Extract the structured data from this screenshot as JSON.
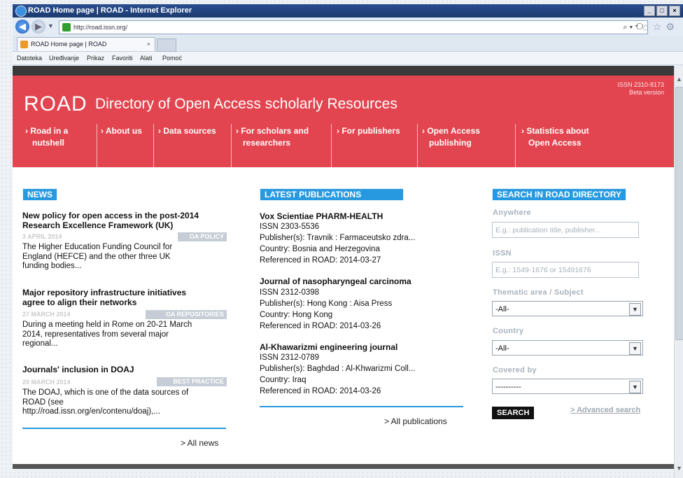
{
  "browser": {
    "title": "ROAD Home page | ROAD - Internet Explorer",
    "url": "http://road.issn.org/",
    "tab_label": "ROAD Home page | ROAD",
    "menu": [
      "Datoteka",
      "Uređivanje",
      "Prikaz",
      "Favoriti",
      "Alati",
      "Pomoć"
    ]
  },
  "header": {
    "issn": "ISSN 2310-8173",
    "beta": "Beta version",
    "logo": "ROAD",
    "subtitle": "Directory of Open Access scholarly Resources",
    "nav": [
      {
        "l1": "› Road in a",
        "l2": "nutshell"
      },
      {
        "l1": "› About us",
        "l2": ""
      },
      {
        "l1": "› Data sources",
        "l2": ""
      },
      {
        "l1": "› For scholars and",
        "l2": "researchers"
      },
      {
        "l1": "› For publishers",
        "l2": ""
      },
      {
        "l1": "› Open Access",
        "l2": "publishing"
      },
      {
        "l1": "› Statistics about",
        "l2": "Open Access"
      }
    ]
  },
  "news": {
    "heading": "NEWS",
    "items": [
      {
        "title1": "New policy for open access in the post-2014",
        "title2": "Research Excellence Framework (UK)",
        "date": "3 APRIL 2014",
        "badge": "OA POLICY",
        "t1": "The Higher Education Funding Council for",
        "t2": "England (HEFCE) and the other three UK",
        "t3": "funding bodies..."
      },
      {
        "title1": "Major repository infrastructure initiatives",
        "title2": "agree to align their networks",
        "date": "27 MARCH 2014",
        "badge": "OA REPOSITORIES",
        "t1": "During a meeting held in Rome on 20-21 March",
        "t2": "2014, representatives from several major",
        "t3": "regional..."
      },
      {
        "title1": "Journals' inclusion in DOAJ",
        "title2": "",
        "date": "20 MARCH 2014",
        "badge": "BEST PRACTICE",
        "t1": "The DOAJ, which is one of the data sources of",
        "t2": "ROAD (see",
        "t3": "http://road.issn.org/en/contenu/doaj),..."
      }
    ],
    "all_news": "> All news"
  },
  "publications": {
    "heading": "LATEST PUBLICATIONS",
    "items": [
      {
        "title": "Vox Scientiae PHARM-HEALTH",
        "issn": "ISSN 2303-5536",
        "publisher": "Publisher(s): Travnik : Farmaceutsko zdra...",
        "country": "Country: Bosnia and Herzegovina",
        "ref": "Referenced in ROAD: 2014-03-27"
      },
      {
        "title": "Journal of nasopharyngeal carcinoma",
        "issn": "ISSN 2312-0398",
        "publisher": "Publisher(s): Hong Kong : Aisa Press",
        "country": "Country: Hong Kong",
        "ref": "Referenced in ROAD: 2014-03-26"
      },
      {
        "title": "Al-Khawarizmi engineering journal",
        "issn": "ISSN 2312-0789",
        "publisher": "Publisher(s): Baghdad : Al-Khwarizmi Coll...",
        "country": "Country: Iraq",
        "ref": "Referenced in ROAD: 2014-03-26"
      }
    ],
    "all_pubs": "> All publications"
  },
  "search": {
    "heading": "SEARCH IN ROAD DIRECTORY",
    "anywhere_label": "Anywhere",
    "anywhere_placeholder": "E.g.: publication title, publisher...",
    "issn_label": "ISSN",
    "issn_placeholder": "E.g.: 1549-1676 or 15491676",
    "thematic_label": "Thematic area / Subject",
    "thematic_value": "-All-",
    "country_label": "Country",
    "country_value": "-All-",
    "covered_label": "Covered by",
    "covered_value": "----------",
    "search_btn": "SEARCH",
    "advanced": "> Advanced search"
  }
}
